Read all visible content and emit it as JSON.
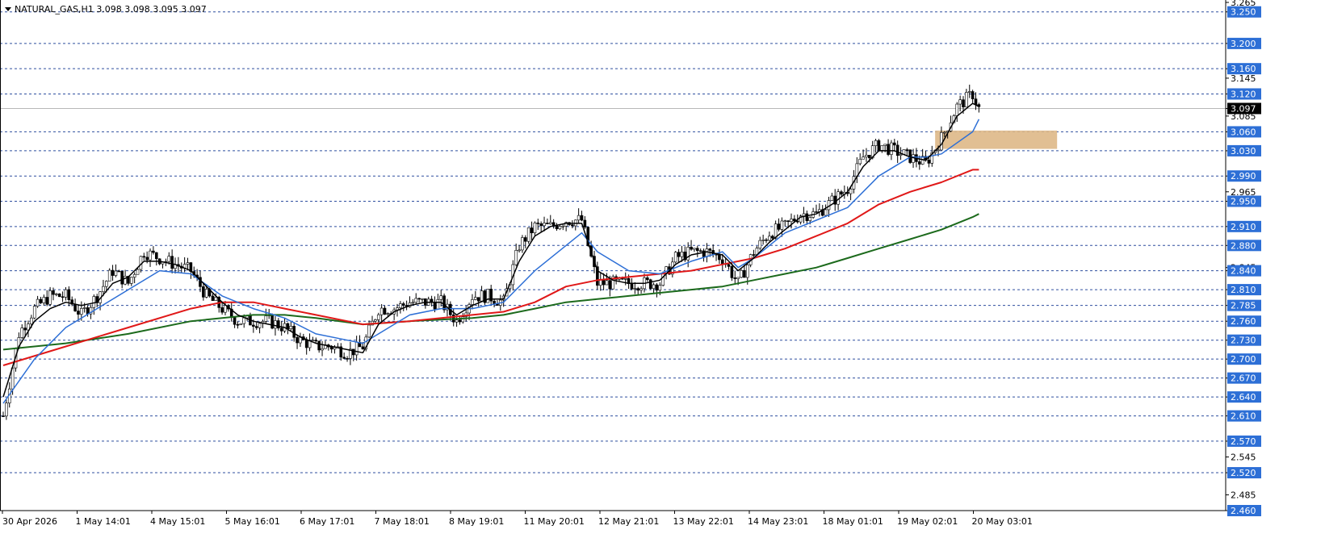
{
  "header": {
    "symbol_line": "NATURAL_GAS,H1  3.098 3.098 3.095 3.097"
  },
  "colors": {
    "background": "#ffffff",
    "grid": "#2f4f9f",
    "candle": "#000000",
    "ma_fast": "#000000",
    "ma_mid": "#2d6fd6",
    "ma_red": "#e01818",
    "ma_green": "#1c6a1c",
    "zone": "#deb887",
    "level_tag_bg": "#2d6fd6",
    "price_tag_bg": "#000000"
  },
  "chart_data": {
    "type": "candlestick",
    "title": "NATURAL_GAS,H1",
    "ohlc_last": {
      "open": 3.098,
      "high": 3.098,
      "low": 3.095,
      "close": 3.097
    },
    "ylim": [
      2.46,
      3.265
    ],
    "last_price": 3.097,
    "grid": true,
    "y_axis_labels": [
      "3.265",
      "3.250",
      "3.200",
      "3.160",
      "3.145",
      "3.120",
      "3.097",
      "3.085",
      "3.060",
      "3.030",
      "2.990",
      "2.965",
      "2.950",
      "2.910",
      "2.880",
      "2.845",
      "2.840",
      "2.810",
      "2.785",
      "2.760",
      "2.730",
      "2.700",
      "2.670",
      "2.640",
      "2.610",
      "2.570",
      "2.545",
      "2.520",
      "2.485",
      "2.460"
    ],
    "level_lines": [
      3.25,
      3.2,
      3.16,
      3.12,
      3.06,
      3.03,
      2.99,
      2.95,
      2.91,
      2.88,
      2.84,
      2.81,
      2.785,
      2.76,
      2.73,
      2.7,
      2.67,
      2.64,
      2.61,
      2.57,
      2.52,
      2.46
    ],
    "plain_ticks": [
      3.265,
      3.145,
      3.085,
      2.965,
      2.845,
      2.545,
      2.485
    ],
    "x_labels": [
      "30 Apr 2026",
      "1 May 14:01",
      "4 May 15:01",
      "5 May 16:01",
      "6 May 17:01",
      "7 May 18:01",
      "8 May 19:01",
      "11 May 20:01",
      "12 May 21:01",
      "13 May 22:01",
      "14 May 23:01",
      "18 May 01:01",
      "19 May 02:01",
      "20 May 03:01"
    ],
    "zone": {
      "price_low": 3.033,
      "price_high": 3.062,
      "bar_start": 298,
      "bar_end": 337
    },
    "series": [
      {
        "name": "",
        "role": "close",
        "x": [
          0,
          5,
          10,
          15,
          20,
          25,
          30,
          35,
          40,
          45,
          50,
          55,
          60,
          65,
          70,
          75,
          80,
          85,
          90,
          95,
          100,
          105,
          110,
          115,
          120,
          125,
          130,
          135,
          140,
          145,
          150,
          155,
          160,
          165,
          170,
          175,
          180,
          185,
          190,
          195,
          200,
          205,
          210,
          215,
          220,
          225,
          230,
          235,
          240,
          245,
          250,
          255,
          260,
          265,
          270,
          275,
          280,
          285,
          290,
          295,
          300,
          305,
          310,
          312
        ],
        "y": [
          2.61,
          2.74,
          2.78,
          2.8,
          2.8,
          2.77,
          2.8,
          2.84,
          2.82,
          2.87,
          2.86,
          2.85,
          2.84,
          2.8,
          2.78,
          2.76,
          2.76,
          2.76,
          2.75,
          2.73,
          2.72,
          2.72,
          2.71,
          2.72,
          2.78,
          2.78,
          2.79,
          2.79,
          2.79,
          2.76,
          2.8,
          2.8,
          2.79,
          2.88,
          2.91,
          2.91,
          2.92,
          2.92,
          2.82,
          2.82,
          2.82,
          2.82,
          2.82,
          2.86,
          2.87,
          2.87,
          2.86,
          2.82,
          2.87,
          2.9,
          2.91,
          2.93,
          2.93,
          2.95,
          2.97,
          3.02,
          3.04,
          3.03,
          3.02,
          3.01,
          3.05,
          3.1,
          3.12,
          3.097
        ]
      },
      {
        "name": "",
        "role": "ma_fast",
        "x": [
          0,
          5,
          10,
          15,
          20,
          25,
          30,
          35,
          40,
          45,
          50,
          55,
          60,
          65,
          70,
          75,
          80,
          85,
          90,
          95,
          100,
          105,
          110,
          115,
          120,
          125,
          130,
          135,
          140,
          145,
          150,
          155,
          160,
          165,
          170,
          175,
          180,
          185,
          190,
          195,
          200,
          205,
          210,
          215,
          220,
          225,
          230,
          235,
          240,
          245,
          250,
          255,
          260,
          265,
          270,
          275,
          280,
          285,
          290,
          295,
          300,
          305,
          310,
          312
        ],
        "y": [
          2.64,
          2.72,
          2.76,
          2.78,
          2.79,
          2.785,
          2.79,
          2.82,
          2.83,
          2.855,
          2.855,
          2.85,
          2.84,
          2.815,
          2.79,
          2.77,
          2.76,
          2.755,
          2.75,
          2.735,
          2.725,
          2.72,
          2.715,
          2.71,
          2.755,
          2.775,
          2.785,
          2.79,
          2.79,
          2.77,
          2.785,
          2.795,
          2.795,
          2.855,
          2.895,
          2.91,
          2.915,
          2.915,
          2.84,
          2.825,
          2.82,
          2.82,
          2.825,
          2.85,
          2.865,
          2.87,
          2.865,
          2.84,
          2.86,
          2.885,
          2.905,
          2.925,
          2.93,
          2.945,
          2.965,
          3.005,
          3.03,
          3.03,
          3.02,
          3.015,
          3.04,
          3.085,
          3.105,
          3.1
        ]
      },
      {
        "name": "",
        "role": "ma_mid",
        "x": [
          0,
          10,
          20,
          30,
          40,
          50,
          60,
          70,
          80,
          90,
          100,
          110,
          115,
          120,
          130,
          140,
          150,
          160,
          170,
          180,
          185,
          190,
          200,
          210,
          220,
          230,
          235,
          240,
          250,
          260,
          270,
          280,
          290,
          295,
          300,
          310,
          312
        ],
        "y": [
          2.63,
          2.7,
          2.75,
          2.78,
          2.81,
          2.84,
          2.835,
          2.8,
          2.78,
          2.765,
          2.74,
          2.73,
          2.725,
          2.74,
          2.77,
          2.78,
          2.78,
          2.79,
          2.84,
          2.88,
          2.9,
          2.87,
          2.84,
          2.835,
          2.855,
          2.87,
          2.845,
          2.86,
          2.9,
          2.92,
          2.94,
          2.99,
          3.02,
          3.02,
          3.025,
          3.06,
          3.08
        ]
      },
      {
        "name": "",
        "role": "ma_red",
        "x": [
          0,
          20,
          40,
          60,
          70,
          80,
          90,
          100,
          115,
          130,
          150,
          160,
          170,
          180,
          190,
          200,
          210,
          220,
          230,
          240,
          250,
          260,
          270,
          280,
          290,
          300,
          310,
          312
        ],
        "y": [
          2.69,
          2.72,
          2.75,
          2.78,
          2.79,
          2.79,
          2.78,
          2.77,
          2.755,
          2.76,
          2.77,
          2.775,
          2.79,
          2.815,
          2.825,
          2.83,
          2.835,
          2.84,
          2.85,
          2.86,
          2.875,
          2.895,
          2.915,
          2.945,
          2.965,
          2.98,
          3.0,
          3.0
        ]
      },
      {
        "name": "",
        "role": "ma_green",
        "x": [
          0,
          20,
          40,
          60,
          70,
          80,
          90,
          100,
          115,
          130,
          150,
          160,
          170,
          180,
          190,
          200,
          210,
          220,
          230,
          240,
          250,
          260,
          270,
          280,
          290,
          300,
          310,
          312
        ],
        "y": [
          2.715,
          2.725,
          2.74,
          2.76,
          2.765,
          2.77,
          2.77,
          2.765,
          2.755,
          2.76,
          2.765,
          2.77,
          2.78,
          2.79,
          2.795,
          2.8,
          2.805,
          2.81,
          2.815,
          2.825,
          2.835,
          2.845,
          2.86,
          2.875,
          2.89,
          2.905,
          2.925,
          2.93
        ]
      }
    ]
  }
}
